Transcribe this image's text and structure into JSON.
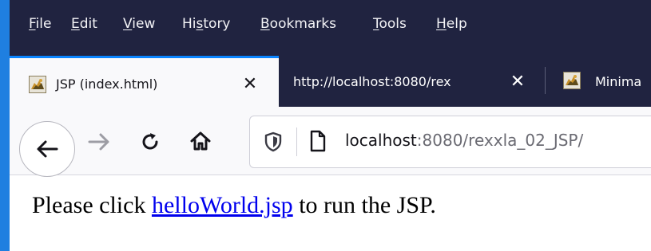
{
  "menu": {
    "items": [
      {
        "access": "F",
        "rest": "ile"
      },
      {
        "access": "E",
        "rest": "dit"
      },
      {
        "access": "V",
        "rest": "iew"
      },
      {
        "pre": "Hi",
        "access": "s",
        "rest": "tory"
      },
      {
        "access": "B",
        "rest": "ookmarks"
      },
      {
        "access": "T",
        "rest": "ools"
      },
      {
        "access": "H",
        "rest": "elp"
      }
    ]
  },
  "tabs": [
    {
      "title": "JSP (index.html)",
      "close": "✕",
      "active": true,
      "favicon": "tomcat-favicon"
    },
    {
      "title": "http://localhost:8080/rex",
      "close": "✕",
      "active": false,
      "favicon": null
    },
    {
      "title": "Minima",
      "active": false,
      "favicon": "tomcat-favicon"
    }
  ],
  "nav": {
    "back_icon": "back-arrow-icon",
    "forward_icon": "forward-arrow-icon",
    "reload_icon": "reload-icon",
    "home_icon": "home-icon"
  },
  "urlbar": {
    "shield_icon": "tracking-protection-shield-icon",
    "page_icon": "page-icon",
    "host": "localhost",
    "rest": ":8080/rexxla_02_JSP/"
  },
  "page": {
    "before_link": "Please click ",
    "link_text": "helloWorld.jsp",
    "after_link": " to run the JSP."
  },
  "colors": {
    "menubar_bg": "#202340",
    "accent": "#0a84ff",
    "link": "#0000ee",
    "window_edge": "#1f7fe0"
  }
}
